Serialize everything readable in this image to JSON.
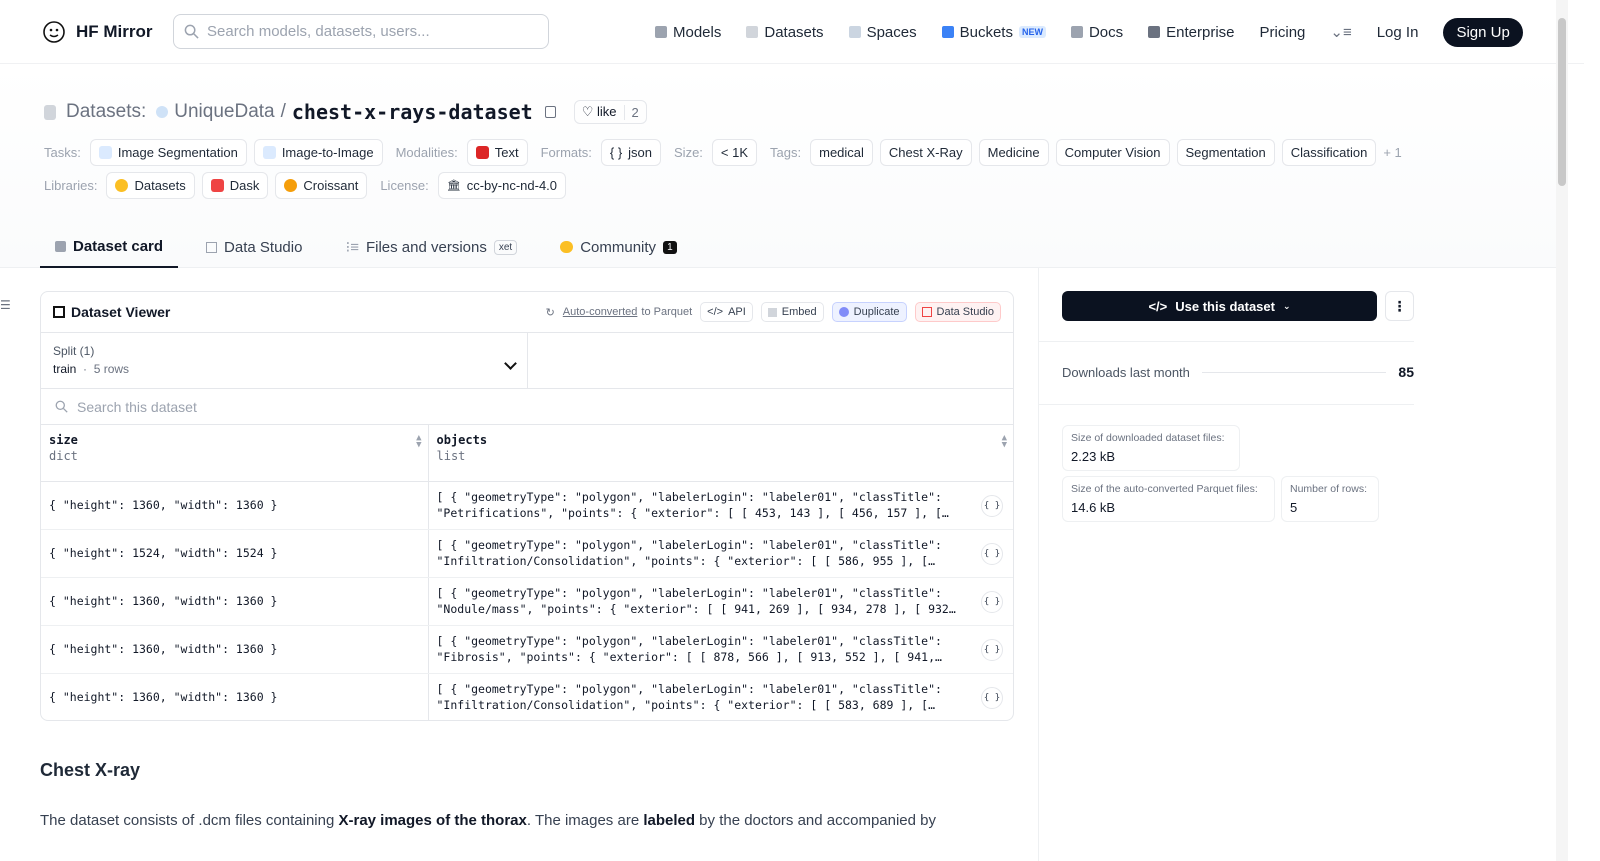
{
  "header": {
    "brand": "HF Mirror",
    "search_placeholder": "Search models, datasets, users...",
    "nav": [
      {
        "label": "Models",
        "icon": "cube-icon"
      },
      {
        "label": "Datasets",
        "icon": "database-icon"
      },
      {
        "label": "Spaces",
        "icon": "grid-icon"
      },
      {
        "label": "Buckets",
        "icon": "bucket-icon",
        "badge": "NEW"
      },
      {
        "label": "Docs",
        "icon": "book-icon"
      },
      {
        "label": "Enterprise",
        "icon": "briefcase-icon"
      },
      {
        "label": "Pricing"
      }
    ],
    "login": "Log In",
    "signup": "Sign Up"
  },
  "repo": {
    "prefix": "Datasets:",
    "org": "UniqueData",
    "sep": "/",
    "name": "chest-x-rays-dataset",
    "like_label": "like",
    "like_count": "2"
  },
  "tags": {
    "tasks_label": "Tasks:",
    "tasks": [
      "Image Segmentation",
      "Image-to-Image"
    ],
    "modalities_label": "Modalities:",
    "modalities": [
      "Text"
    ],
    "formats_label": "Formats:",
    "formats": [
      "json"
    ],
    "size_label": "Size:",
    "size": "< 1K",
    "tags_label": "Tags:",
    "tags": [
      "medical",
      "Chest X-Ray",
      "Medicine",
      "Computer Vision",
      "Segmentation",
      "Classification"
    ],
    "more": "+ 1",
    "libraries_label": "Libraries:",
    "libraries": [
      "Datasets",
      "Dask",
      "Croissant"
    ],
    "license_label": "License:",
    "license": "cc-by-nc-nd-4.0"
  },
  "tabs": [
    {
      "label": "Dataset card",
      "active": true
    },
    {
      "label": "Data Studio"
    },
    {
      "label": "Files and versions",
      "badge": "xet"
    },
    {
      "label": "Community",
      "badge": "1"
    }
  ],
  "viewer": {
    "title": "Dataset Viewer",
    "auto_converted": "Auto-converted",
    "to_parquet": "to Parquet",
    "api": "API",
    "embed": "Embed",
    "duplicate": "Duplicate",
    "data_studio": "Data Studio",
    "split_label": "Split (1)",
    "split_name": "train",
    "split_rows": "5 rows",
    "search_placeholder": "Search this dataset",
    "columns": [
      {
        "name": "size",
        "type": "dict"
      },
      {
        "name": "objects",
        "type": "list"
      }
    ],
    "rows": [
      {
        "size": "{ \"height\": 1360, \"width\": 1360 }",
        "objects": "[ { \"geometryType\": \"polygon\", \"labelerLogin\": \"labeler01\", \"classTitle\": \"Petrifications\", \"points\": { \"exterior\": [ [ 453, 143 ], [ 456, 157 ], […"
      },
      {
        "size": "{ \"height\": 1524, \"width\": 1524 }",
        "objects": "[ { \"geometryType\": \"polygon\", \"labelerLogin\": \"labeler01\", \"classTitle\": \"Infiltration/Consolidation\", \"points\": { \"exterior\": [ [ 586, 955 ], […"
      },
      {
        "size": "{ \"height\": 1360, \"width\": 1360 }",
        "objects": "[ { \"geometryType\": \"polygon\", \"labelerLogin\": \"labeler01\", \"classTitle\": \"Nodule/mass\", \"points\": { \"exterior\": [ [ 941, 269 ], [ 934, 278 ], [ 932…"
      },
      {
        "size": "{ \"height\": 1360, \"width\": 1360 }",
        "objects": "[ { \"geometryType\": \"polygon\", \"labelerLogin\": \"labeler01\", \"classTitle\": \"Fibrosis\", \"points\": { \"exterior\": [ [ 878, 566 ], [ 913, 552 ], [ 941,…"
      },
      {
        "size": "{ \"height\": 1360, \"width\": 1360 }",
        "objects": "[ { \"geometryType\": \"polygon\", \"labelerLogin\": \"labeler01\", \"classTitle\": \"Infiltration/Consolidation\", \"points\": { \"exterior\": [ [ 583, 689 ], […"
      }
    ]
  },
  "card": {
    "heading": "Chest X-ray",
    "p_start": "The dataset consists of .dcm files containing ",
    "p_bold1": "X-ray images of the thorax",
    "p_mid": ". The images are ",
    "p_bold2": "labeled",
    "p_end": " by the doctors and accompanied by"
  },
  "sidebar": {
    "use_button": "Use this dataset",
    "downloads_label": "Downloads last month",
    "downloads": "85",
    "dl_size_label": "Size of downloaded dataset files:",
    "dl_size": "2.23 kB",
    "parquet_label": "Size of the auto-converted Parquet files:",
    "parquet_size": "14.6 kB",
    "rows_label": "Number of rows:",
    "rows": "5"
  },
  "colors": {
    "accent_dark": "#0b1220",
    "text_red": "#dc2626",
    "link_blue": "#2563eb"
  }
}
